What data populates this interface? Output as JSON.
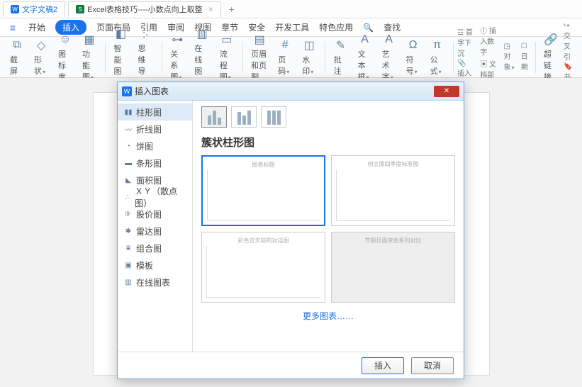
{
  "tabs": {
    "t1": "文字文稿2",
    "t2": "Excel表格技巧----小数点向上取整",
    "new": "+"
  },
  "menu": {
    "hamb": "≡",
    "start": "开始",
    "insert": "插入",
    "layout": "页面布局",
    "ref": "引用",
    "review": "审阅",
    "view": "视图",
    "chapter": "章节",
    "security": "安全",
    "dev": "开发工具",
    "special": "特色应用",
    "search_ic": "🔍",
    "search": "查找"
  },
  "ribbon": {
    "screenshot": "截屏",
    "shape": "形状",
    "iconlib": "图标库",
    "funcimg": "功能图",
    "smartart": "智能图形",
    "mindmap": "思维导图",
    "relation": "关系图",
    "onlinechart": "在线图表",
    "flow": "流程图",
    "headerfooter": "页眉和页脚",
    "pagenum": "页码",
    "watermark": "水印",
    "comment": "批注",
    "textbox": "文本框",
    "wordart": "艺术字",
    "symbol": "符号",
    "formula": "公式",
    "dropcap": "首字下沉",
    "insnum": "插入数字",
    "obj": "对象",
    "datetime": "日期",
    "attach": "插入附件",
    "docpart": "文档部件",
    "hyperlink": "超链接",
    "crossref": "交叉引",
    "bookmark": "书签"
  },
  "dialog": {
    "title": "插入图表",
    "side": {
      "column": "柱形图",
      "line": "折线图",
      "pie": "饼图",
      "bar": "条形图",
      "area": "面积图",
      "xy": "ＸＹ（散点图）",
      "stock": "股价图",
      "radar": "雷达图",
      "combo": "组合图",
      "template": "模板",
      "online": "在线图表"
    },
    "section": "簇状柱形图",
    "pv1": "图表标题",
    "pv2": "创立面四季度标准图",
    "pv3": "彩色云天际的对话图",
    "pv4": "节假日面资金系列对比",
    "more": "更多图表……",
    "insert": "插入",
    "cancel": "取消"
  }
}
